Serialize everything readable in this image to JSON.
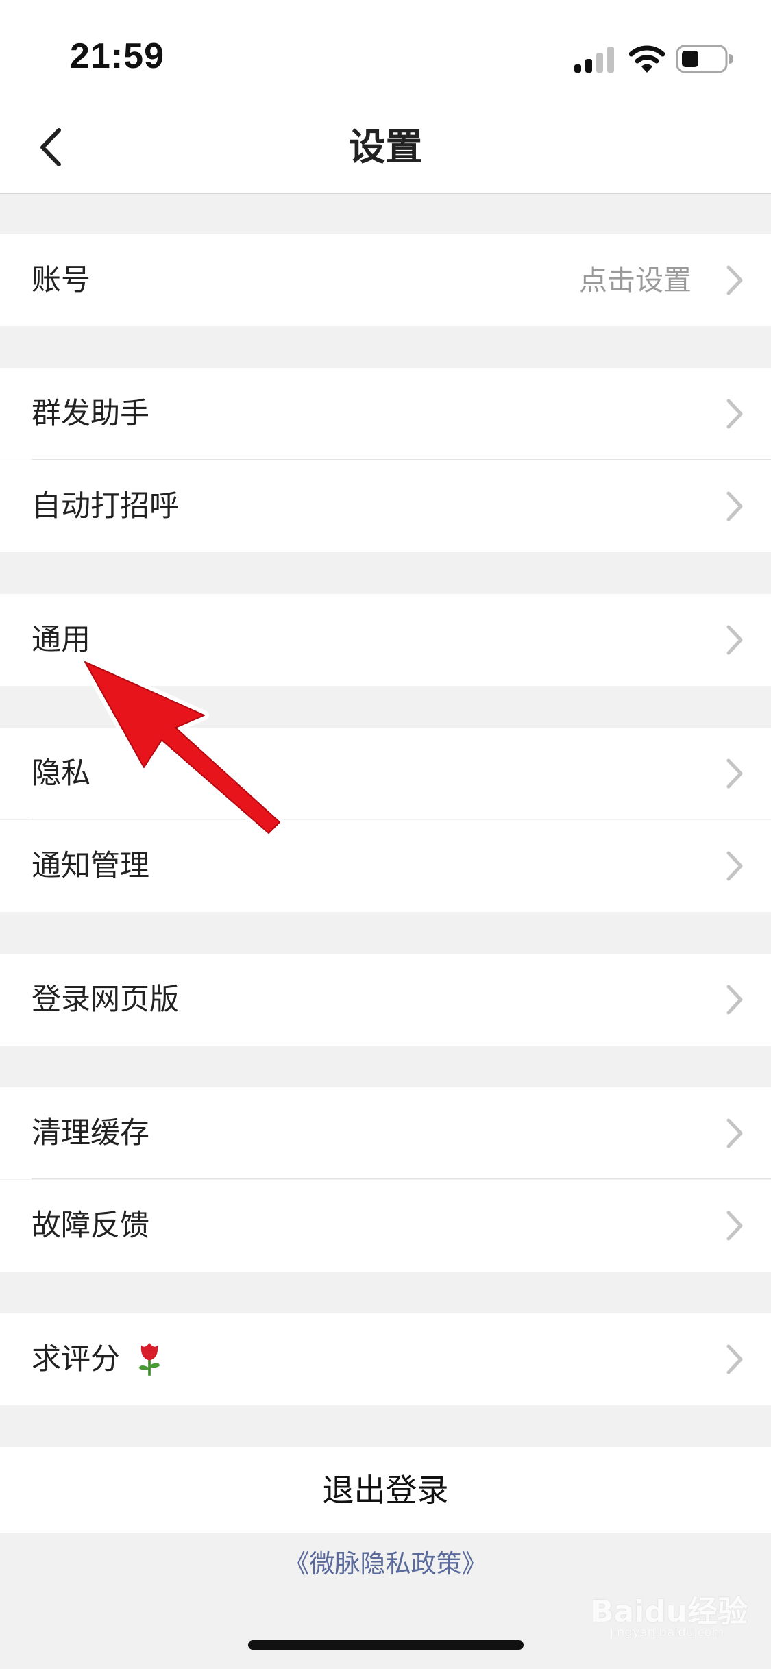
{
  "status_bar": {
    "time": "21:59"
  },
  "nav": {
    "title": "设置"
  },
  "rows": [
    {
      "label": "账号",
      "value": "点击设置"
    },
    {
      "label": "群发助手"
    },
    {
      "label": "自动打招呼"
    },
    {
      "label": "通用"
    },
    {
      "label": "隐私"
    },
    {
      "label": "通知管理"
    },
    {
      "label": "登录网页版"
    },
    {
      "label": "清理缓存"
    },
    {
      "label": "故障反馈"
    },
    {
      "label": "求评分"
    }
  ],
  "logout": {
    "label": "退出登录"
  },
  "privacy_link": {
    "label": "《微脉隐私政策》"
  },
  "watermark": {
    "text": "Baidu经验",
    "sub": "jingyan.baidu.com"
  },
  "colors": {
    "annotation_arrow": "#e8141c",
    "chevron": "#c4c4c4"
  },
  "icons": [
    "signal-icon",
    "wifi-icon",
    "battery-icon",
    "back-arrow-icon",
    "chevron-right-icon",
    "rose-icon",
    "annotation-arrow"
  ]
}
